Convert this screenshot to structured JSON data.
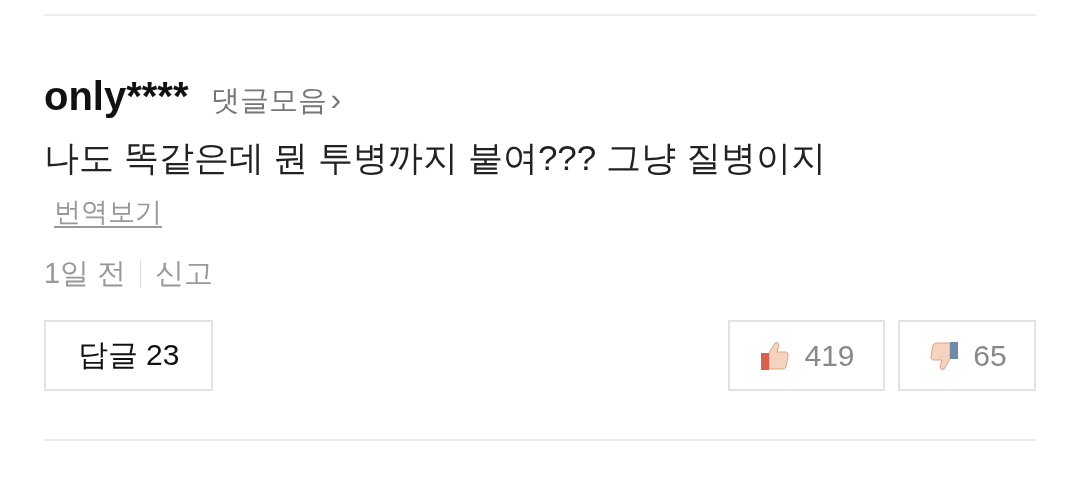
{
  "comment": {
    "author": "only****",
    "collection_link": "댓글모음",
    "collection_arrow": "›",
    "text": "나도 똑같은데 뭔 투병까지 붙여??? 그냥 질병이지",
    "translate_link": "번역보기",
    "time": "1일 전",
    "report_link": "신고"
  },
  "reply_button": {
    "label": "답글",
    "count": "23"
  },
  "votes": [
    {
      "kind": "up",
      "count": "419"
    },
    {
      "kind": "down",
      "count": "65"
    }
  ]
}
